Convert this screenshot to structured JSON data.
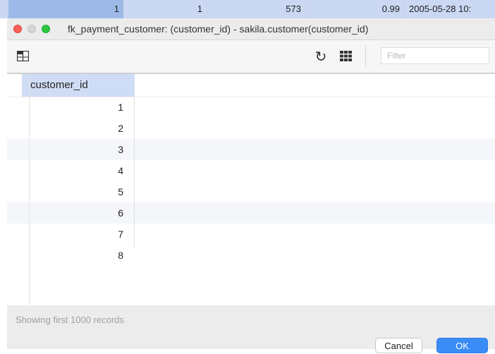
{
  "background_row": {
    "cells": [
      "1",
      "1",
      "573",
      "0.99",
      "2005-05-28 10:"
    ]
  },
  "dialog": {
    "title": "fk_payment_customer: (customer_id) - sakila.customer(customer_id)",
    "toolbar": {
      "columns_icon": "columns-icon",
      "refresh_icon": "refresh-icon",
      "grid_icon": "grid-icon",
      "filter_placeholder": "Filter"
    },
    "table": {
      "column": "customer_id",
      "rows": [
        "1",
        "2",
        "3",
        "4",
        "5",
        "6",
        "7",
        "8"
      ]
    },
    "footer": {
      "status": "Showing first 1000 records",
      "cancel_label": "Cancel",
      "ok_label": "OK"
    }
  },
  "colors": {
    "selection": "#9db9e8",
    "header": "#cfdcf5",
    "ok_button": "#3a8cf7",
    "close": "#fe5f57",
    "maximize": "#2bc840"
  }
}
